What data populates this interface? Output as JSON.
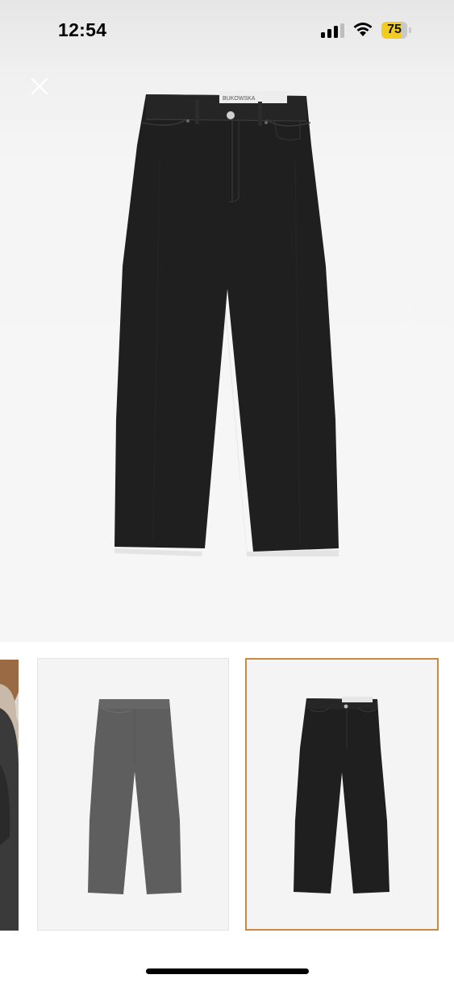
{
  "status_bar": {
    "time": "12:54",
    "battery_level": "75",
    "battery_fraction": 0.75,
    "battery_color": "#f2cc22"
  },
  "header": {
    "close_icon": "close-icon"
  },
  "product": {
    "main_image": "black-straight-leg-jeans-front",
    "label_text": "BUKOWSKA",
    "thumbnails": [
      {
        "name": "model-photo-partial",
        "selected": false
      },
      {
        "name": "grey-jeans-back",
        "selected": false
      },
      {
        "name": "black-jeans-front",
        "selected": true
      }
    ],
    "selected_border_color": "#c9893f"
  }
}
